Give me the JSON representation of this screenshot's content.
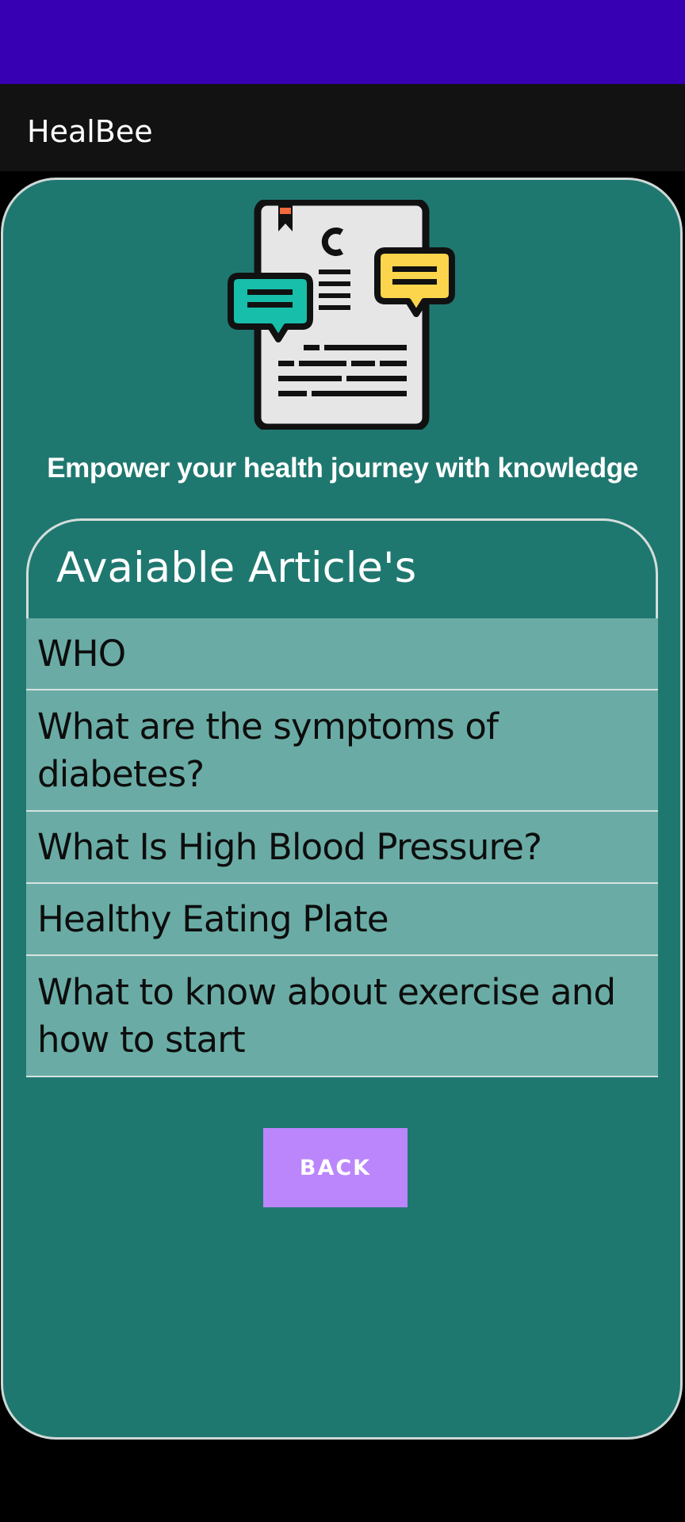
{
  "app": {
    "title": "HealBee"
  },
  "hero": {
    "icon": "medical-article-chat-icon"
  },
  "tagline": "Empower your health journey with knowledge",
  "articles": {
    "title": "Avaiable Article's",
    "items": [
      {
        "label": "WHO"
      },
      {
        "label": "What are the symptoms of diabetes?"
      },
      {
        "label": "What Is High Blood Pressure?"
      },
      {
        "label": "Healthy Eating Plate"
      },
      {
        "label": "What to know about exercise and how to start"
      }
    ]
  },
  "buttons": {
    "back": "BACK"
  },
  "colors": {
    "status_bar": "#3700b3",
    "app_bar": "#121212",
    "card_background": "#1f7870",
    "list_item_background": "#6aaca5",
    "button_background": "#bb86fc"
  }
}
